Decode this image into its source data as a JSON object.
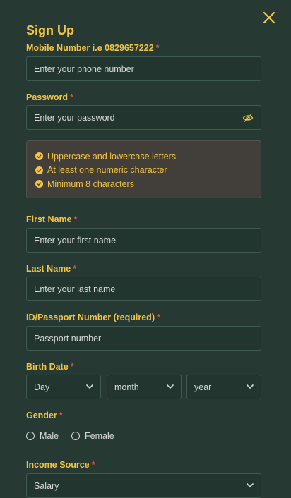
{
  "header": {
    "title": "Sign Up",
    "close_icon": "close-icon"
  },
  "mobile": {
    "label": "Mobile Number i.e 0829657222",
    "required": "*",
    "placeholder": "Enter your phone number"
  },
  "password": {
    "label": "Password",
    "required": "*",
    "placeholder": "Enter your password",
    "toggle_icon": "eye-slash-icon",
    "rules": [
      "Uppercase and lowercase letters",
      "At least one numeric character",
      "Minimum 8 characters"
    ]
  },
  "first_name": {
    "label": "First Name",
    "required": "*",
    "placeholder": "Enter your first name"
  },
  "last_name": {
    "label": "Last Name",
    "required": "*",
    "placeholder": "Enter your last name"
  },
  "id_number": {
    "label": "ID/Passport Number (required)",
    "required": "*",
    "placeholder": "Passport number"
  },
  "birth_date": {
    "label": "Birth Date",
    "required": "*",
    "day": "Day",
    "month": "month",
    "year": "year"
  },
  "gender": {
    "label": "Gender",
    "required": "*",
    "options": [
      "Male",
      "Female"
    ]
  },
  "income": {
    "label": "Income Source",
    "required": "*",
    "value": "Salary"
  },
  "colors": {
    "background": "#263a33",
    "accent": "#f4c443",
    "required": "#e0543e",
    "panel": "#423f3a"
  }
}
